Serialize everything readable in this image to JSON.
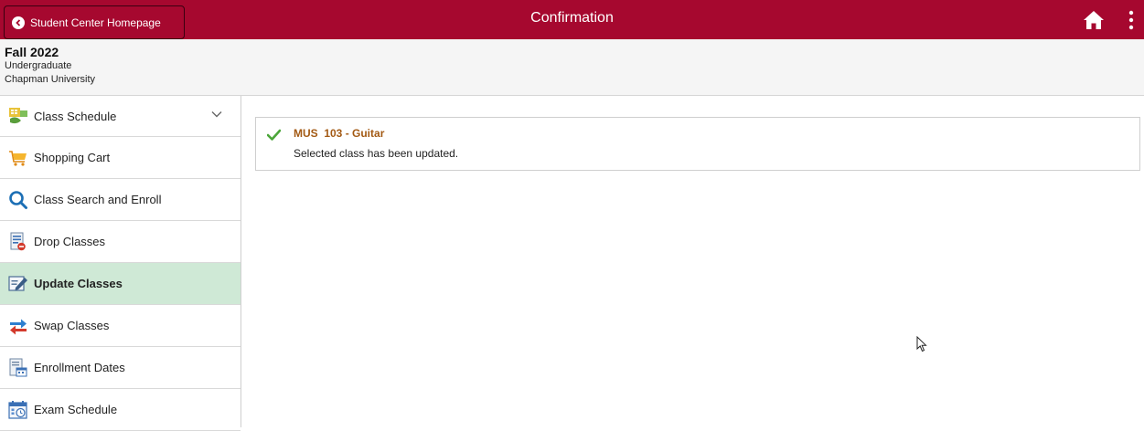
{
  "header": {
    "back_label": "Student Center Homepage",
    "title": "Confirmation",
    "home_icon": "home-icon",
    "menu_icon": "kebab-menu-icon",
    "color": "#a6082f"
  },
  "context": {
    "term": "Fall 2022",
    "career": "Undergraduate",
    "institution": "Chapman University"
  },
  "sidebar": {
    "items": [
      {
        "label": "Class Schedule",
        "icon": "schedule-icon"
      },
      {
        "label": "Shopping Cart",
        "icon": "cart-icon"
      },
      {
        "label": "Class Search and Enroll",
        "icon": "search-icon"
      },
      {
        "label": "Drop Classes",
        "icon": "drop-icon"
      },
      {
        "label": "Update Classes",
        "icon": "update-icon"
      },
      {
        "label": "Swap Classes",
        "icon": "swap-icon"
      },
      {
        "label": "Enrollment Dates",
        "icon": "calendar-icon"
      },
      {
        "label": "Exam Schedule",
        "icon": "exam-icon"
      }
    ],
    "active_color": "#cfe9d6"
  },
  "confirmation": {
    "class_name": "MUS  103 - Guitar",
    "message": "Selected class has been updated."
  }
}
